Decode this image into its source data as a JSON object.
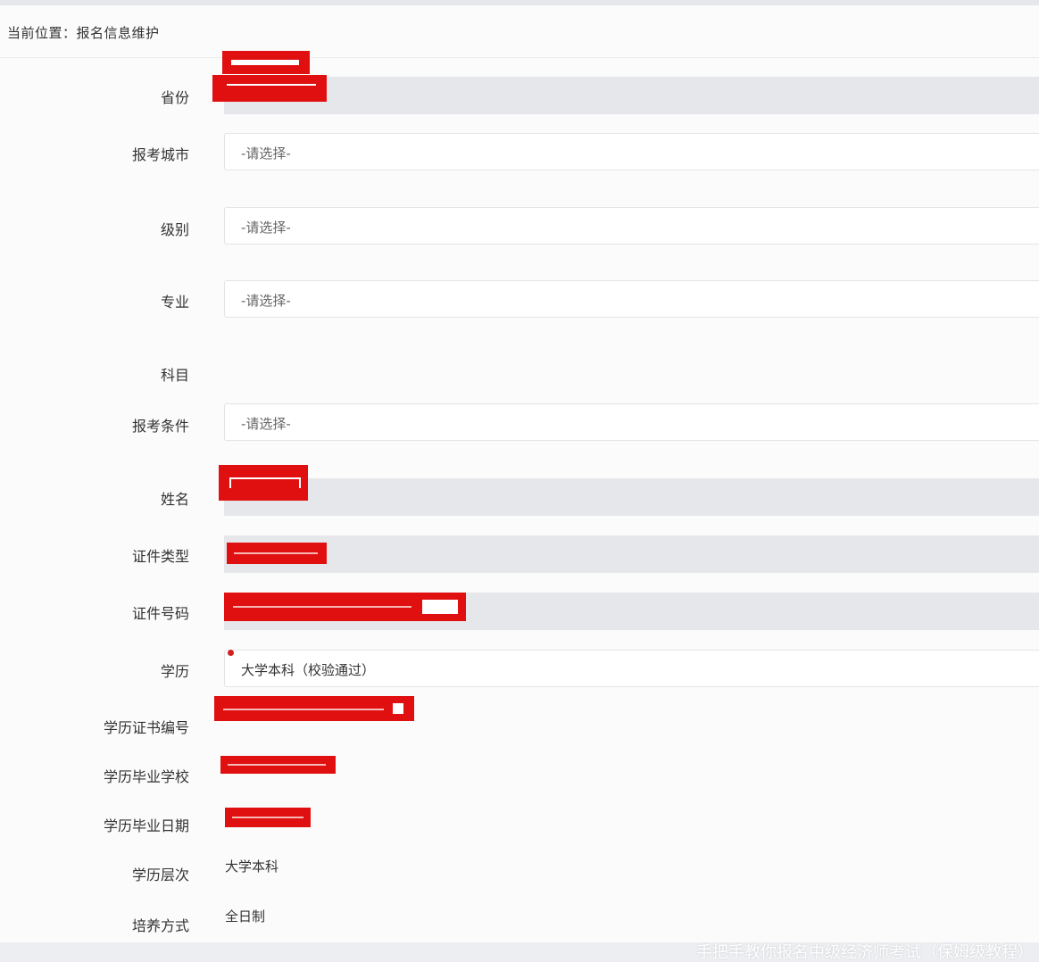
{
  "breadcrumb": "当前位置：报名信息维护",
  "form": {
    "province_label": "省份",
    "city_label": "报考城市",
    "city_value": "-请选择-",
    "level_label": "级别",
    "level_value": "-请选择-",
    "major_label": "专业",
    "major_value": "-请选择-",
    "subject_label": "科目",
    "condition_label": "报考条件",
    "condition_value": "-请选择-",
    "name_label": "姓名",
    "id_type_label": "证件类型",
    "id_number_label": "证件号码",
    "education_label": "学历",
    "education_value": "大学本科（校验通过）",
    "cert_no_label": "学历证书编号",
    "school_label": "学历毕业学校",
    "grad_date_label": "学历毕业日期",
    "edu_level_label": "学历层次",
    "edu_level_value": "大学本科",
    "study_mode_label": "培养方式",
    "study_mode_value": "全日制"
  },
  "watermark": "手把手教你报名中级经济师考试（保姆级教程）",
  "colors": {
    "redaction": "#e01010",
    "disabled_field": "#e6e7ea",
    "required_dot": "#d02020"
  }
}
